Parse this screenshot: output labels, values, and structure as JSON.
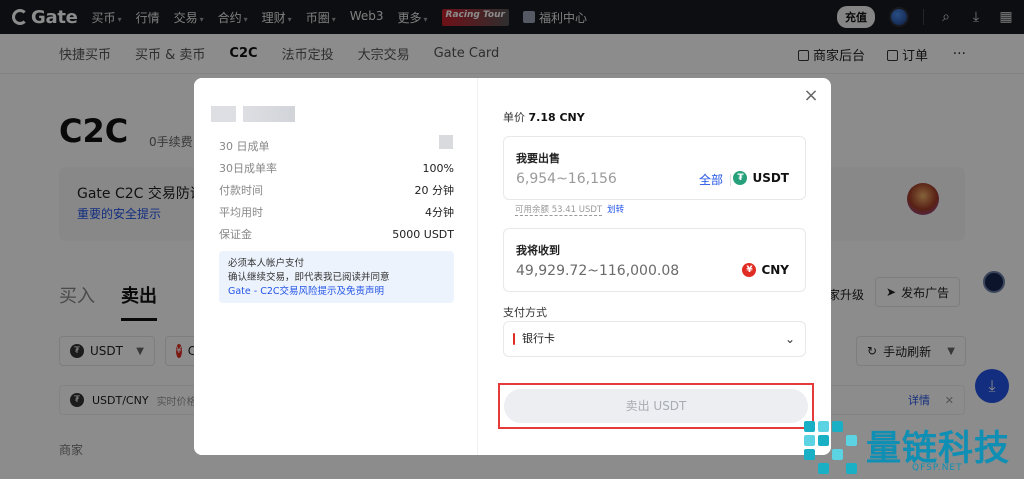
{
  "topnav": {
    "logo": "Gate",
    "items": [
      "买币",
      "行情",
      "交易",
      "合约",
      "理财",
      "币圈",
      "Web3",
      "更多"
    ],
    "racing": "Racing Tour",
    "welfare": "福利中心",
    "charge": "充值"
  },
  "subnav": {
    "items": [
      "快捷买币",
      "买币 & 卖币",
      "C2C",
      "法币定投",
      "大宗交易",
      "Gate Card"
    ],
    "merchant": "商家后台",
    "orders": "订单",
    "more": "···"
  },
  "page": {
    "title": "C2C",
    "subtitle": "0手续费",
    "notice_title": "Gate C2C 交易防诈",
    "notice_link": "重要的安全提示",
    "tab_buy": "买入",
    "tab_sell": "卖出",
    "filter_coin": "USDT",
    "filter_fiat": "C",
    "refresh": "手动刷新",
    "upgrade": "家升级",
    "post_ad": "发布广告",
    "pair": "USDT/CNY",
    "realtime_price": "实时价格",
    "detail": "详情",
    "merchant_col": "商家"
  },
  "modal": {
    "stats": [
      {
        "k": "30 日成单",
        "v": ""
      },
      {
        "k": "30日成单率",
        "v": "100%"
      },
      {
        "k": "付款时间",
        "v": "20 分钟"
      },
      {
        "k": "平均用时",
        "v": "4分钟"
      },
      {
        "k": "保证金",
        "v": "5000 USDT"
      }
    ],
    "info_line1": "必须本人帐户支付",
    "info_line2": "确认继续交易，即代表我已阅读并同意",
    "info_link": "Gate - C2C交易风险提示及免责声明",
    "price_label": "单价",
    "price_value": "7.18 CNY",
    "sell_label": "我要出售",
    "sell_range": "6,954~16,156",
    "sell_all": "全部",
    "sell_currency": "USDT",
    "available": "可用余额 53.41 USDT",
    "transfer": "划转",
    "receive_label": "我将收到",
    "receive_range": "49,929.72~116,000.08",
    "receive_currency": "CNY",
    "pay_label": "支付方式",
    "pay_value": "银行卡",
    "sell_button": "卖出 USDT",
    "close": "×"
  },
  "watermark": {
    "text": "量链科技",
    "url": "QFSP.NET"
  }
}
